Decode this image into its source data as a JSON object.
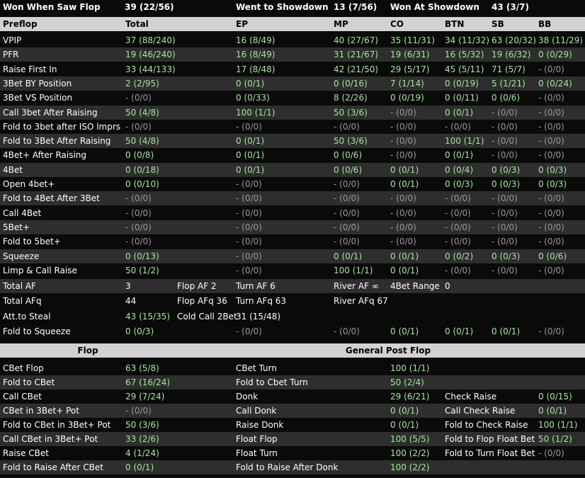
{
  "top_bar": {
    "won_when_saw_flop_label": "Won When Saw Flop",
    "won_when_saw_flop_value": "39 (22/56)",
    "went_to_showdown_label": "Went to Showdown",
    "went_to_showdown_value": "13 (7/56)",
    "won_at_showdown_label": "Won At Showdown",
    "won_at_showdown_value": "43 (3/7)"
  },
  "preflop": {
    "headers": [
      "Preflop",
      "Total",
      "EP",
      "MP",
      "CO",
      "BTN",
      "SB",
      "BB"
    ],
    "rows": [
      [
        "VPIP",
        "37 (88/240)",
        "16 (8/49)",
        "40 (27/67)",
        "35 (11/31)",
        "34 (11/32)",
        "63 (20/32)",
        "38 (11/29)"
      ],
      [
        "PFR",
        "19 (46/240)",
        "16 (8/49)",
        "31 (21/67)",
        "19 (6/31)",
        "16 (5/32)",
        "19 (6/32)",
        "0 (0/29)"
      ],
      [
        "Raise First In",
        "33 (44/133)",
        "17 (8/48)",
        "42 (21/50)",
        "29 (5/17)",
        "45 (5/11)",
        "71 (5/7)",
        "- (0/0)"
      ],
      [
        "3Bet BY Position",
        "2 (2/95)",
        "0 (0/1)",
        "0 (0/16)",
        "7 (1/14)",
        "0 (0/19)",
        "5 (1/21)",
        "0 (0/24)"
      ],
      [
        "3Bet VS Position",
        "- (0/0)",
        "0 (0/33)",
        "8 (2/26)",
        "0 (0/19)",
        "0 (0/11)",
        "0 (0/6)",
        "- (0/0)"
      ],
      [
        "Call 3bet After Raising",
        "50 (4/8)",
        "100 (1/1)",
        "50 (3/6)",
        "- (0/0)",
        "0 (0/1)",
        "- (0/0)",
        "- (0/0)"
      ],
      [
        "Fold to 3bet after ISO lmprs",
        "- (0/0)",
        "- (0/0)",
        "- (0/0)",
        "- (0/0)",
        "- (0/0)",
        "- (0/0)",
        "- (0/0)"
      ],
      [
        "Fold to 3Bet After Raising",
        "50 (4/8)",
        "0 (0/1)",
        "50 (3/6)",
        "- (0/0)",
        "100 (1/1)",
        "- (0/0)",
        "- (0/0)"
      ],
      [
        "4Bet+ After Raising",
        "0 (0/8)",
        "0 (0/1)",
        "0 (0/6)",
        "- (0/0)",
        "0 (0/1)",
        "- (0/0)",
        "- (0/0)"
      ],
      [
        "4Bet",
        "0 (0/18)",
        "0 (0/1)",
        "0 (0/6)",
        "0 (0/1)",
        "0 (0/4)",
        "0 (0/3)",
        "0 (0/3)"
      ],
      [
        "Open 4bet+",
        "0 (0/10)",
        "- (0/0)",
        "- (0/0)",
        "0 (0/1)",
        "0 (0/3)",
        "0 (0/3)",
        "0 (0/3)"
      ],
      [
        "Fold to 4Bet After 3Bet",
        "- (0/0)",
        "- (0/0)",
        "- (0/0)",
        "- (0/0)",
        "- (0/0)",
        "- (0/0)",
        "- (0/0)"
      ],
      [
        "Call 4Bet",
        "- (0/0)",
        "- (0/0)",
        "- (0/0)",
        "- (0/0)",
        "- (0/0)",
        "- (0/0)",
        "- (0/0)"
      ],
      [
        "5Bet+",
        "- (0/0)",
        "- (0/0)",
        "- (0/0)",
        "- (0/0)",
        "- (0/0)",
        "- (0/0)",
        "- (0/0)"
      ],
      [
        "Fold to 5bet+",
        "- (0/0)",
        "- (0/0)",
        "- (0/0)",
        "- (0/0)",
        "- (0/0)",
        "- (0/0)",
        "- (0/0)"
      ],
      [
        "Squeeze",
        "0 (0/13)",
        "- (0/0)",
        "0 (0/1)",
        "0 (0/1)",
        "0 (0/2)",
        "0 (0/3)",
        "0 (0/6)"
      ],
      [
        "Limp & Call Raise",
        "50 (1/2)",
        "- (0/0)",
        "100 (1/1)",
        "0 (0/1)",
        "- (0/0)",
        "- (0/0)",
        "- (0/0)"
      ]
    ]
  },
  "summary": {
    "total_af_label": "Total AF",
    "total_af_value": "3",
    "flop_af": "Flop AF 2",
    "turn_af": "Turn AF 6",
    "river_af": "River AF ∞",
    "fourbet_range_label": "4Bet Range",
    "fourbet_range_value": "0",
    "total_afq_label": "Total AFq",
    "total_afq_value": "44",
    "flop_afq": "Flop AFq 36",
    "turn_afq": "Turn AFq 63",
    "river_afq": "River AFq 67",
    "att_steal_label": "Att.to Steal",
    "att_steal_value": "43 (15/35)",
    "cold_call_label": "Cold Call 2Bet",
    "cold_call_value": "31 (15/48)",
    "fold_squeeze_label": "Fold to Squeeze",
    "fold_squeeze": [
      "0 (0/3)",
      "- (0/0)",
      "- (0/0)",
      "0 (0/1)",
      "0 (0/1)",
      "0 (0/1)",
      "- (0/0)"
    ]
  },
  "postflop": {
    "flop_header": "Flop",
    "general_header": "General Post Flop",
    "rows": [
      [
        "CBet Flop",
        "63 (5/8)",
        "CBet Turn",
        "100 (1/1)",
        "",
        ""
      ],
      [
        "Fold to CBet",
        "67 (16/24)",
        "Fold to Cbet Turn",
        "50 (2/4)",
        "",
        ""
      ],
      [
        "Call CBet",
        "29 (7/24)",
        "Donk",
        "29 (6/21)",
        "Check Raise",
        "0 (0/15)"
      ],
      [
        "CBet in 3Bet+ Pot",
        "- (0/0)",
        "Call Donk",
        "0 (0/1)",
        "Call Check Raise",
        "0 (0/1)"
      ],
      [
        "Fold to CBet in 3Bet+ Pot",
        "50 (3/6)",
        "Raise Donk",
        "0 (0/1)",
        "Fold to Check Raise",
        "100 (1/1)"
      ],
      [
        "Call CBet in 3Bet+ Pot",
        "33 (2/6)",
        "Float Flop",
        "100 (5/5)",
        "Fold to Flop Float Bet",
        "50 (1/2)"
      ],
      [
        "Raise CBet",
        "4 (1/24)",
        "Float Turn",
        "100 (2/2)",
        "Fold to Turn Float Bet",
        "- (0/0)"
      ],
      [
        "Fold to Raise After CBet",
        "0 (0/1)",
        "Fold to Raise After Donk",
        "100 (2/2)",
        "",
        ""
      ]
    ]
  },
  "colors": {
    "stat_green": "#a6e6a0",
    "alt_row": "#2e2e2e",
    "header_bg": "#d2d2d2"
  }
}
